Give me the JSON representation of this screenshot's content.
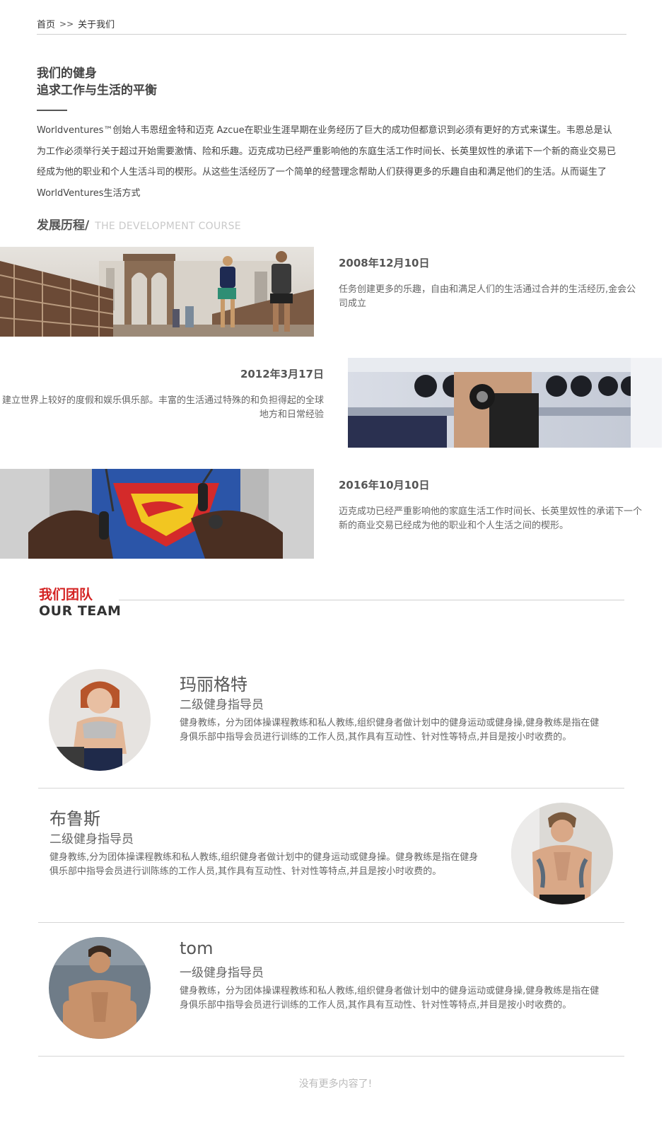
{
  "breadcrumb": {
    "home": "首页",
    "separator": ">>",
    "current": "关于我们"
  },
  "intro": {
    "title_line1": "我们的健身",
    "title_line2": "追求工作与生活的平衡",
    "paragraph": "Worldventures™创始人韦恩纽金特和迈克 Azcue在职业生涯早期在业务经历了巨大的成功但都意识到必须有更好的方式来谋生。韦恩总是认为工作必须举行关于超过开始需要激情、险和乐趣。迈克成功已经严重影响他的东庭生活工作时间长、长英里奴性的承诺下一个新的商业交易已经成为他的职业和个人生活斗司的楔形。从这些生活经历了一个简单的经营理念帮助人们获得更多的乐趣自由和满足他们的生活。从而诞生了 WorldVentures生活方式"
  },
  "development": {
    "heading_cn": "发展历程/",
    "heading_en": "THE DEVELOPMENT COURSE",
    "events": [
      {
        "date": "2008年12月10日",
        "desc": "任务创建更多的乐趣，自由和满足人们的生活通过合并的生活经历,金会公司成立",
        "image": "bridge-runners-photo"
      },
      {
        "date": "2012年3月17日",
        "desc": "建立世界上较好的度假和娱乐俱乐部。丰富的生活通过特殊的和负担得起的全球地方和日常经验",
        "image": "dumbbell-workout-photo"
      },
      {
        "date": "2016年10月10日",
        "desc": "迈克成功已经严重影响他的家庭生活工作时间长、长英里奴性的承诺下一个新的商业交易已经成为他的职业和个人生活之间的楔形。",
        "image": "cable-training-photo"
      }
    ]
  },
  "team": {
    "heading_cn": "我们团队",
    "heading_en": "OUR TEAM",
    "members": [
      {
        "name": "玛丽格特",
        "role": "二级健身指导员",
        "desc": "健身教练，分为团体操课程教练和私人教练,组织健身者做计划中的健身运动或健身操,健身教练是指在健身俱乐部中指导会员进行训练的工作人员,其作具有互动性、针对性等特点,并目是按小时收费的。"
      },
      {
        "name": "布鲁斯",
        "role": "二级健身指导员",
        "desc": "健身教练,分为团体操课程教练和私人教练,组织健身者做计划中的健身运动或健身操。健身教练是指在健身俱乐部中指导会员进行训陈练的工作人员,其作具有互动性、针对性等特点,并且是按小时收费的。"
      },
      {
        "name": "tom",
        "role": "一级健身指导员",
        "desc": "健身教练，分为团体操课程教练和私人教练,组织健身者做计划中的健身运动或健身操,健身教练是指在健身俱乐部中指导会员进行训练的工作人员,其作具有互动性、针对性等特点,并目是按小时收费的。"
      }
    ]
  },
  "footer": {
    "no_more": "没有更多内容了!"
  },
  "colors": {
    "accent": "#d42222",
    "text": "#333333",
    "muted": "#666666",
    "divider": "#cfcfcf"
  }
}
